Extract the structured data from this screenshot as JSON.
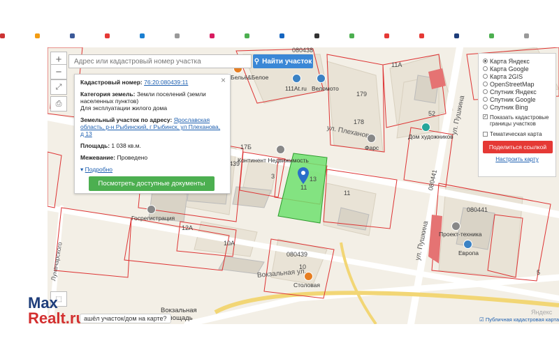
{
  "browser": {
    "bookmarks": [
      {
        "color": "#cc3333"
      },
      {
        "color": "#f39c12"
      },
      {
        "color": "#3b5998"
      },
      {
        "color": "#e53935"
      },
      {
        "color": "#1a7fd1"
      },
      {
        "color": "#999999"
      },
      {
        "color": "#d81b60"
      },
      {
        "color": "#4caf50"
      },
      {
        "color": "#1565c0"
      },
      {
        "color": "#333333"
      },
      {
        "color": "#4caf50"
      },
      {
        "color": "#e53935"
      },
      {
        "color": "#e53935"
      },
      {
        "color": "#1e3d7a"
      },
      {
        "color": "#4caf50"
      },
      {
        "color": "#999999"
      }
    ]
  },
  "map_controls": {
    "zoom_in": "+",
    "zoom_out": "−",
    "search_placeholder": "Адрес или кадастровый номер участка",
    "find_button": "Найти участок"
  },
  "parcel": {
    "cadastral_number_label": "Кадастровый номер:",
    "cadastral_number": "76:20:080439:11",
    "category_label": "Категория земель:",
    "category_value": "Земли поселений (земли населенных пунктов)",
    "use_value": "Для эксплуатации жилого дома",
    "address_label": "Земельный участок по адресу:",
    "address_value": "Ярославская область, р-н Рыбинский, г Рыбинск, ул Плеханова, д 13",
    "area_label": "Площадь:",
    "area_value": "1 038 кв.м.",
    "survey_label": "Межевание:",
    "survey_value": "Проведено",
    "details_link": "Подробно",
    "docs_button": "Посмотреть доступные документы"
  },
  "layers": {
    "options": [
      {
        "label": "Карта Яндекс",
        "selected": true
      },
      {
        "label": "Карта Google",
        "selected": false
      },
      {
        "label": "Карта 2GIS",
        "selected": false
      },
      {
        "label": "OpenStreetMap",
        "selected": false
      },
      {
        "label": "Спутник Яндекс",
        "selected": false
      },
      {
        "label": "Спутник Google",
        "selected": false
      },
      {
        "label": "Спутник Bing",
        "selected": false
      }
    ],
    "show_boundaries": "Показать кадастровые границы участков",
    "thematic": "Тематическая карта",
    "share_button": "Поделиться ссылкой",
    "setup_link": "Настроить карту"
  },
  "map_labels": {
    "streets": {
      "plekhanova": "ул. Плеханова",
      "pushkina1": "ул. Пушкина",
      "pushkina2": "ул. Пушкина",
      "vokzalnaya": "Вокзальная ул.",
      "vokzalnaya_sq1": "Вокзальная",
      "vokzalnaya_sq2": "площадь",
      "lunacharsky": "Луначарского"
    },
    "places": {
      "beloe": "Бельё&Белое",
      "kontinent": "Континент Недвижимость",
      "gosreg": "Госрегистрация",
      "fars": "Фарс",
      "dom_hud": "Дом художников",
      "proekt": "Проект-техника",
      "evropa": "Европа",
      "stolovaya": "Столовая",
      "veloмото": "Веломото",
      "a111": "111At.ru"
    },
    "numbers": [
      "080438",
      "11А",
      "179",
      "178",
      "52",
      "17Б",
      "439",
      "3",
      "11",
      "13",
      "11",
      "12А",
      "10А",
      "080439",
      "10",
      "080441",
      "080441",
      "5"
    ]
  },
  "footer": {
    "watermark_max": "Max",
    "watermark_realt": "Realt.ru",
    "tip": "ашёл участок/дом на карте?",
    "credit": "Публичная кадастровая карта",
    "yandex": "Яндекс"
  }
}
